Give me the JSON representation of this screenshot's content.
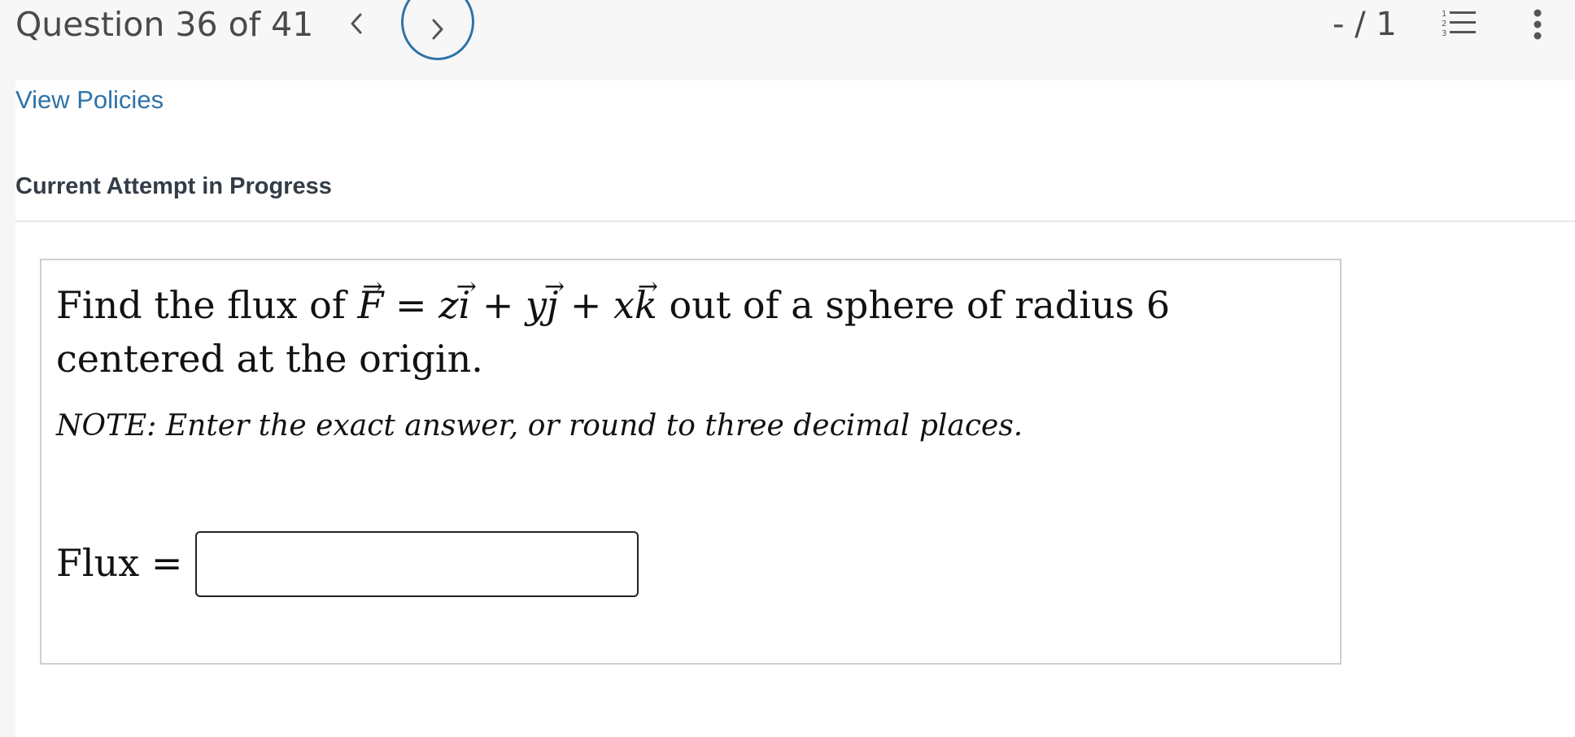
{
  "header": {
    "question_counter": "Question 36 of 41",
    "score": "- / 1"
  },
  "icons": {
    "prev": "chevron-left-icon",
    "next": "chevron-right-icon",
    "list": "numbered-list-icon",
    "more": "more-vertical-icon"
  },
  "links": {
    "view_policies": "View Policies"
  },
  "status": {
    "attempt": "Current Attempt in Progress"
  },
  "question": {
    "prefix": "Find the flux of",
    "eq": "=",
    "plus": "+",
    "suffix": "out of a sphere of radius 6 centered at the origin.",
    "var_F": "F",
    "coef_z": "z",
    "vec_i": "i",
    "coef_y": "y",
    "vec_j": "j",
    "coef_x": "x",
    "vec_k": "k",
    "note": "NOTE: Enter the exact answer, or round to three decimal places."
  },
  "answer": {
    "label": "Flux =",
    "value": ""
  },
  "colors": {
    "accent": "#2f73a8",
    "header_bg": "#f7f7f7",
    "text_dark": "#333d47"
  }
}
